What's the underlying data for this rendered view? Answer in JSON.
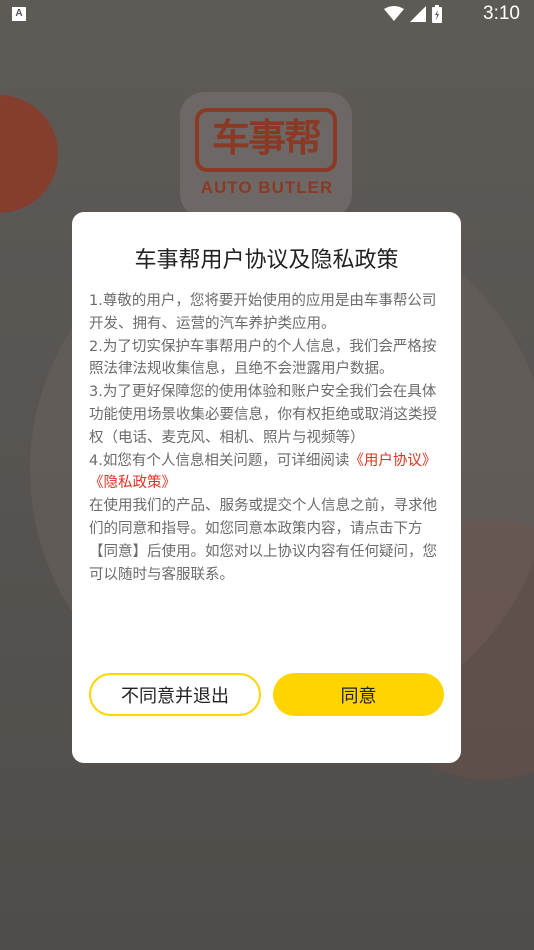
{
  "status_bar": {
    "app_icon_letter": "A",
    "time": "3:10"
  },
  "splash": {
    "logo_chars": "车事帮",
    "logo_text": "AUTO BUTLER"
  },
  "dialog": {
    "title": "车事帮用户协议及隐私政策",
    "paragraphs": {
      "p1": "1.尊敬的用户，您将要开始使用的应用是由车事帮公司开发、拥有、运营的汽车养护类应用。",
      "p2": " 2.为了切实保护车事帮用户的个人信息，我们会严格按照法律法规收集信息，且绝不会泄露用户数据。",
      "p3": " 3.为了更好保障您的使用体验和账户安全我们会在具体功能使用场景收集必要信息，你有权拒绝或取消这类授权（电话、麦克风、相机、照片与视频等）",
      "p4_prefix": " 4.如您有个人信息相关问题，可详细阅读",
      "p4_link_user": "《用户协议》",
      "p4_link_privacy": "《隐私政策》",
      "p5": "在使用我们的产品、服务或提交个人信息之前，寻求他们的同意和指导。如您同意本政策内容，请点击下方【同意】后使用。如您对以上协议内容有任何疑问，您可以随时与客服联系。"
    },
    "decline_label": "不同意并退出",
    "agree_label": "同意"
  },
  "colors": {
    "accent": "#ffd400",
    "link": "#e0321f"
  }
}
